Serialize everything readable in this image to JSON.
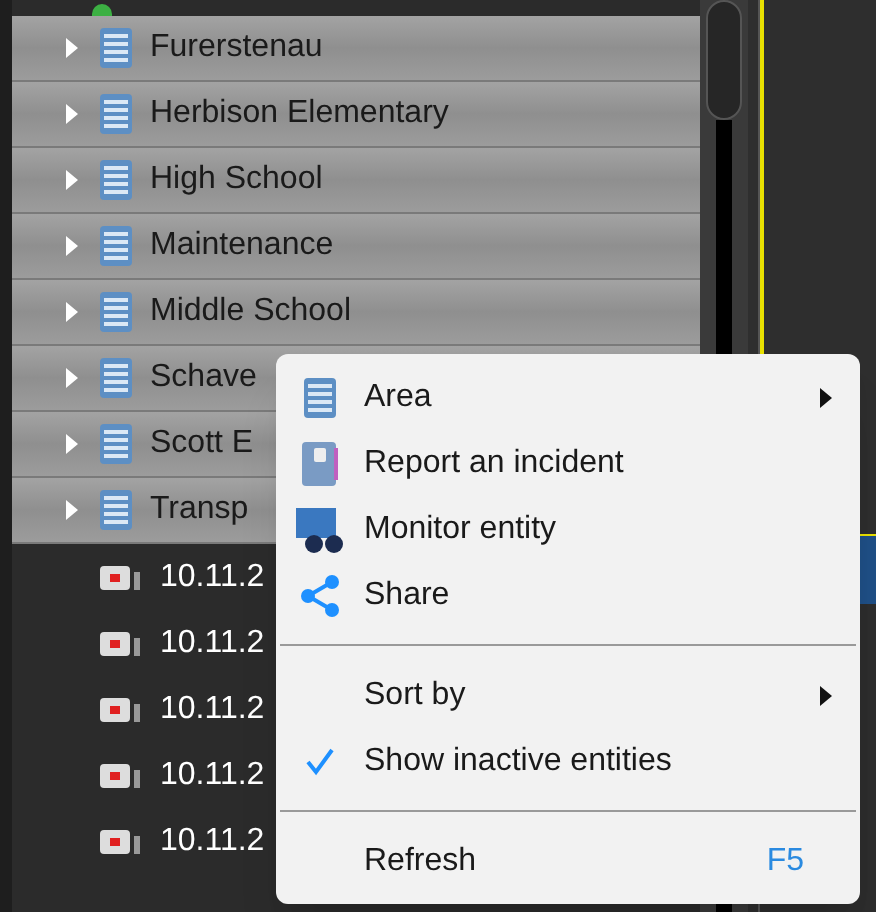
{
  "tree": {
    "areas": [
      {
        "label": "Furerstenau",
        "expanded": false
      },
      {
        "label": "Herbison Elementary",
        "expanded": false
      },
      {
        "label": "High School",
        "expanded": false
      },
      {
        "label": "Maintenance",
        "expanded": false
      },
      {
        "label": "Middle School",
        "expanded": false
      },
      {
        "label": "Schave",
        "expanded": false
      },
      {
        "label": "Scott E",
        "expanded": false
      },
      {
        "label": "Transp",
        "expanded": false
      }
    ],
    "cameras": [
      {
        "label": "10.11.2"
      },
      {
        "label": "10.11.2"
      },
      {
        "label": "10.11.2"
      },
      {
        "label": "10.11.2"
      },
      {
        "label": "10.11.2"
      }
    ]
  },
  "context_menu": {
    "items": [
      {
        "kind": "submenu",
        "label": "Area"
      },
      {
        "kind": "command",
        "label": "Report an incident"
      },
      {
        "kind": "command",
        "label": "Monitor entity"
      },
      {
        "kind": "command",
        "label": "Share"
      },
      {
        "kind": "separator"
      },
      {
        "kind": "submenu",
        "label": "Sort by"
      },
      {
        "kind": "toggle",
        "label": "Show inactive entities",
        "checked": true
      },
      {
        "kind": "separator"
      },
      {
        "kind": "command",
        "label": "Refresh",
        "shortcut": "F5"
      }
    ]
  }
}
